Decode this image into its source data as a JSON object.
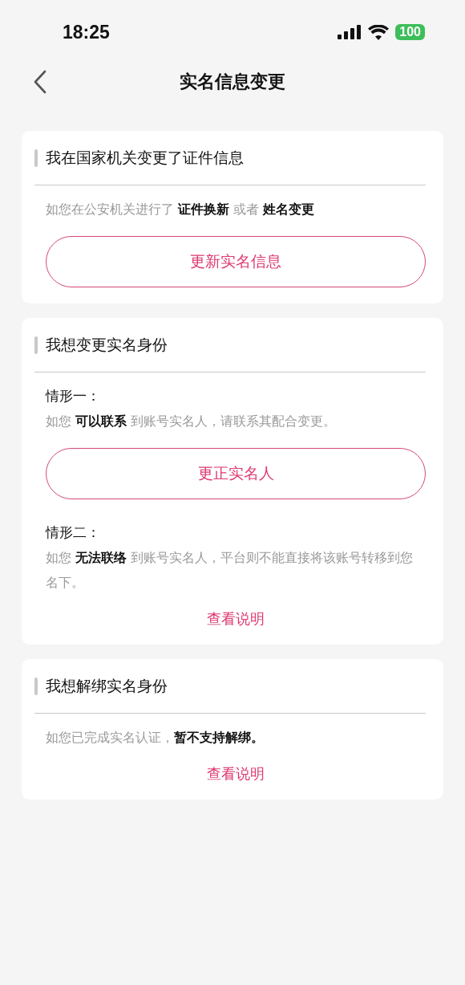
{
  "status_bar": {
    "time": "18:25",
    "battery": "100"
  },
  "nav": {
    "title": "实名信息变更"
  },
  "cards": [
    {
      "title": "我在国家机关变更了证件信息",
      "blocks": [
        {
          "kind": "text",
          "text": "如您在公安机关进行了 **证件换新** 或者 **姓名变更**"
        },
        {
          "kind": "button",
          "text": "更新实名信息"
        }
      ]
    },
    {
      "title": "我想变更实名身份",
      "blocks": [
        {
          "kind": "case",
          "text": "情形一："
        },
        {
          "kind": "text",
          "text": "如您 **可以联系** 到账号实名人，请联系其配合变更。"
        },
        {
          "kind": "button",
          "text": "更正实名人"
        },
        {
          "kind": "case",
          "text": "情形二："
        },
        {
          "kind": "text",
          "text": "如您 **无法联络** 到账号实名人，平台则不能直接将该账号转移到您名下。"
        },
        {
          "kind": "link",
          "text": "查看说明"
        }
      ]
    },
    {
      "title": "我想解绑实名身份",
      "blocks": [
        {
          "kind": "text",
          "text": "如您已完成实名认证，**暂不支持解绑。**"
        },
        {
          "kind": "link",
          "text": "查看说明"
        }
      ]
    }
  ]
}
